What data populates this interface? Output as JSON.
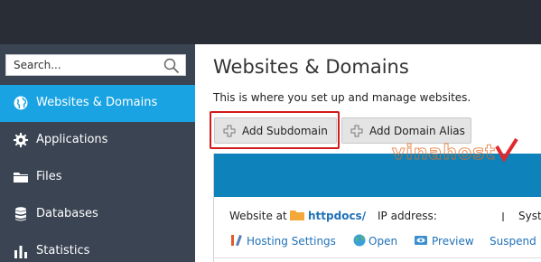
{
  "search": {
    "placeholder": "Search...",
    "icon": "search-icon"
  },
  "sidebar": {
    "items": [
      {
        "label": "Websites & Domains",
        "icon": "globe-icon",
        "active": true
      },
      {
        "label": "Applications",
        "icon": "gear-icon",
        "active": false
      },
      {
        "label": "Files",
        "icon": "folder-icon",
        "active": false
      },
      {
        "label": "Databases",
        "icon": "database-icon",
        "active": false
      },
      {
        "label": "Statistics",
        "icon": "bar-chart-icon",
        "active": false
      }
    ]
  },
  "main": {
    "title": "Websites & Domains",
    "subtitle": "This is where you set up and manage websites.",
    "buttons": {
      "add_subdomain": "Add Subdomain",
      "add_domain_alias": "Add Domain Alias"
    },
    "watermark": "vinahost",
    "domain": {
      "website_at_label": "Website at",
      "docroot": "httpdocs/",
      "ip_label": "IP address:",
      "system_label": "Syst",
      "actions": [
        {
          "label": "Hosting Settings",
          "icon": "wrench-icon"
        },
        {
          "label": "Open",
          "icon": "open-globe-icon"
        },
        {
          "label": "Preview",
          "icon": "preview-icon"
        },
        {
          "label": "Suspend",
          "icon": "suspend-icon"
        }
      ]
    }
  },
  "colors": {
    "topbar": "#282d36",
    "sidebar": "#3a4453",
    "active_item": "#19a3e2",
    "highlight_border": "#d11a1a",
    "link": "#1f71b8",
    "panel_band": "#0e82ba"
  }
}
